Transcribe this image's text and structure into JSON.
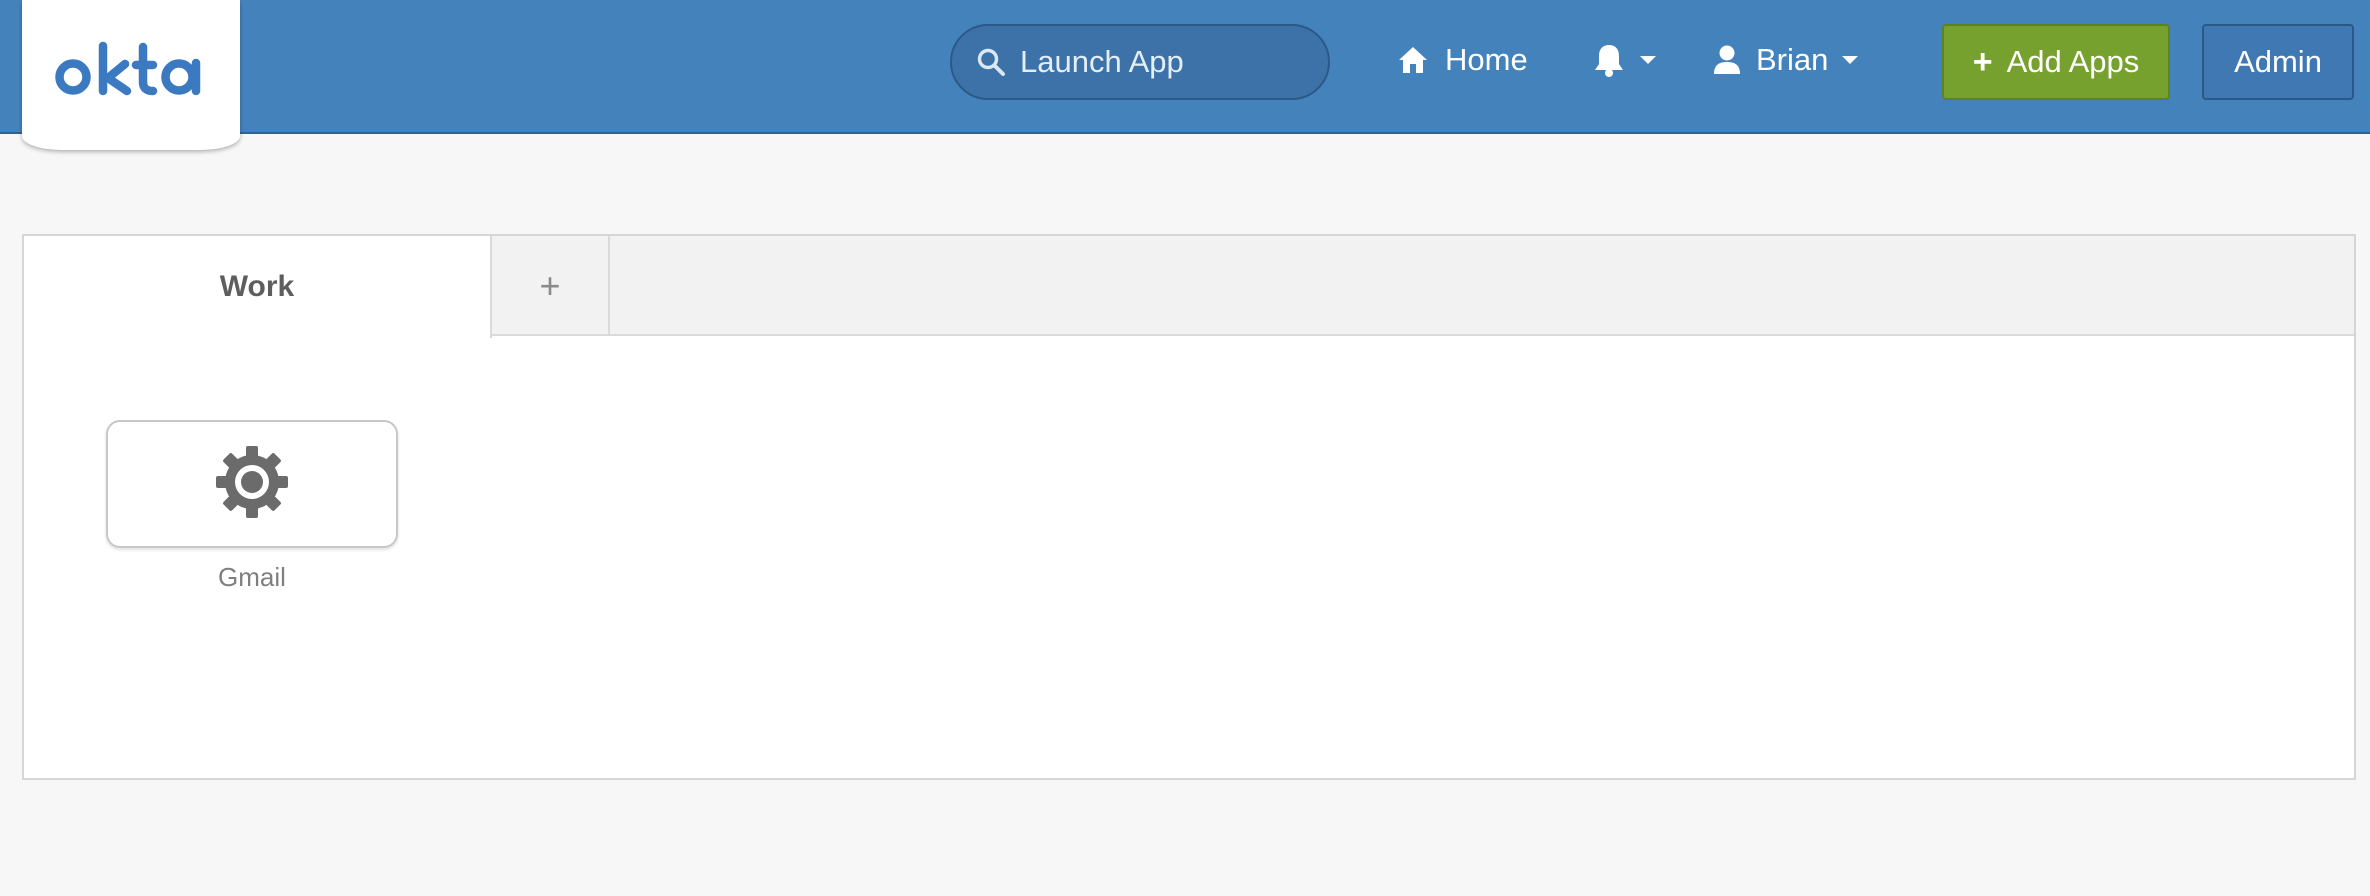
{
  "header": {
    "logo_text": "okta",
    "search": {
      "placeholder": "Launch App",
      "value": "",
      "icon": "search-icon"
    },
    "nav": {
      "home_label": "Home",
      "home_icon": "home-icon",
      "notifications_icon": "bell-icon",
      "user_label": "Brian",
      "user_icon": "user-icon"
    },
    "add_apps_label": "Add Apps",
    "add_apps_icon": "+",
    "admin_label": "Admin"
  },
  "dashboard": {
    "tabs": [
      {
        "label": "Work",
        "active": true
      }
    ],
    "add_tab_label": "+",
    "apps": [
      {
        "label": "Gmail",
        "icon": "gear-icon"
      }
    ]
  },
  "colors": {
    "header_bg": "#4482bc",
    "add_button_bg": "#77a12f",
    "admin_button_bg": "#3f78b2",
    "page_bg": "#f7f7f7"
  }
}
